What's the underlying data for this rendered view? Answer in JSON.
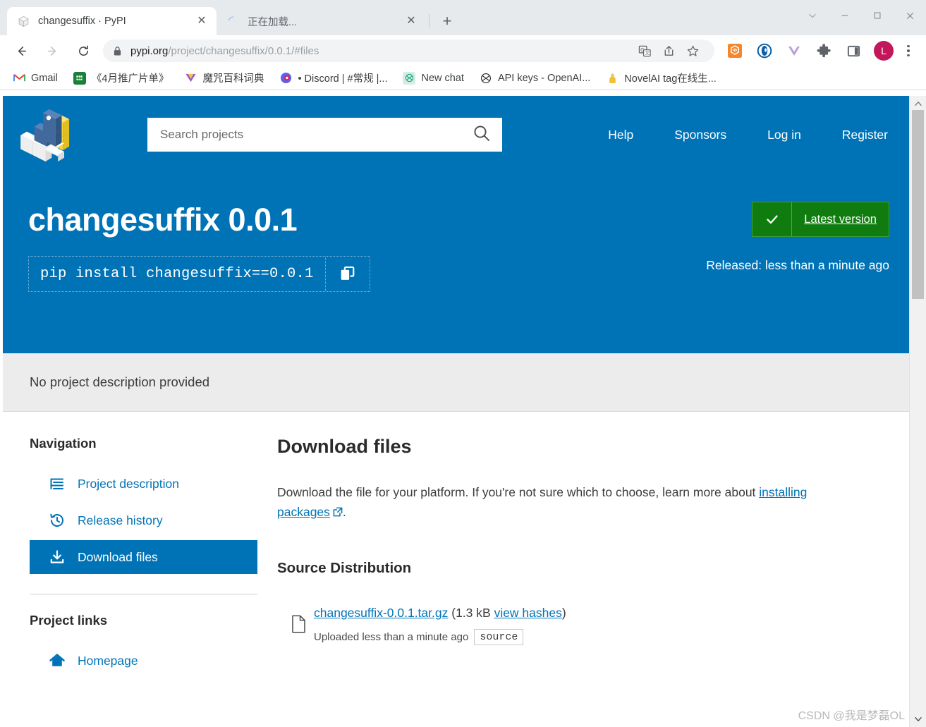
{
  "browser": {
    "tabs": [
      {
        "title": "changesuffix · PyPI",
        "active": true,
        "favicon": "package-icon",
        "close_label": "✕"
      },
      {
        "title": "正在加载...",
        "active": false,
        "favicon": "loading-spinner-icon",
        "close_label": "✕"
      }
    ],
    "new_tab_label": "+",
    "window_controls": {
      "tab_search": "⌄",
      "minimize": "—",
      "maximize": "□",
      "close": "✕"
    },
    "toolbar": {
      "back_label": "←",
      "forward_label": "→",
      "reload_label": "↻",
      "url_prefix": "pypi.org",
      "url_suffix": "/project/changesuffix/0.0.1/#files",
      "lock_icon": "lock-icon",
      "translate_icon": "translate-icon",
      "share_icon": "share-icon",
      "bookmark_icon": "star-icon",
      "profile_initial": "L"
    },
    "extensions": [
      {
        "name": "honey-extension-icon",
        "glyph": "✚",
        "color": "#f5872a"
      },
      {
        "name": "opera-gx-extension-icon",
        "glyph": "◉",
        "color": "#0b5fa5"
      },
      {
        "name": "vue-devtools-extension-icon",
        "glyph": "▼",
        "color": "#b9a0d6"
      },
      {
        "name": "puzzle-extensions-icon",
        "glyph": "✻",
        "color": "#5f6368"
      },
      {
        "name": "sidepanel-icon",
        "glyph": "▣",
        "color": "#5f6368"
      }
    ],
    "bookmarks": [
      {
        "label": "Gmail",
        "icon": "gmail-icon",
        "glyph": "M",
        "color": "#ea4335",
        "bg": "transparent"
      },
      {
        "label": "《4月推广片单》",
        "icon": "google-sheets-icon",
        "glyph": "≡",
        "color": "#ffffff",
        "bg": "#188038"
      },
      {
        "label": "魔咒百科词典",
        "icon": "v-site-icon",
        "glyph": "▼",
        "color": "#8e44ad",
        "bg": "transparent"
      },
      {
        "label": "• Discord | #常规 |...",
        "icon": "discord-icon",
        "glyph": "◉",
        "color": "#e01e5a",
        "bg": "transparent"
      },
      {
        "label": "New chat",
        "icon": "chatgpt-icon",
        "glyph": "◎",
        "color": "#10a37f",
        "bg": "#e6f4ef"
      },
      {
        "label": "API keys - OpenAI...",
        "icon": "openai-icon",
        "glyph": "◎",
        "color": "#202123",
        "bg": "transparent"
      },
      {
        "label": "NovelAI tag在线生...",
        "icon": "novelai-icon",
        "glyph": "♟",
        "color": "#d4a017",
        "bg": "transparent"
      }
    ]
  },
  "pypi": {
    "logo_name": "pypi-logo",
    "search": {
      "placeholder": "Search projects",
      "value": "",
      "icon": "search-icon"
    },
    "nav": [
      {
        "label": "Help"
      },
      {
        "label": "Sponsors"
      },
      {
        "label": "Log in"
      },
      {
        "label": "Register"
      }
    ],
    "banner": {
      "package_title": "changesuffix 0.0.1",
      "pip_command": "pip install changesuffix==0.0.1",
      "copy_icon": "copy-icon",
      "version_badge": {
        "check": "✓",
        "label": "Latest version"
      },
      "released": "Released: less than a minute ago"
    },
    "description_notice": "No project description provided",
    "sidebar": {
      "navigation_heading": "Navigation",
      "nav_items": [
        {
          "label": "Project description",
          "icon": "list-lines-icon",
          "active": false
        },
        {
          "label": "Release history",
          "icon": "history-clock-icon",
          "active": false
        },
        {
          "label": "Download files",
          "icon": "download-icon",
          "active": true
        }
      ],
      "project_links_heading": "Project links",
      "project_links": [
        {
          "label": "Homepage",
          "icon": "home-icon"
        }
      ]
    },
    "main": {
      "heading": "Download files",
      "lead_before": "Download the file for your platform. If you're not sure which to choose, learn more about ",
      "lead_link": "installing packages",
      "lead_after": ".",
      "external_icon": "external-link-icon",
      "section_heading": "Source Distribution",
      "file": {
        "icon": "file-icon",
        "name": "changesuffix-0.0.1.tar.gz",
        "size_open": " (",
        "size": "1.3 kB",
        "hashes_link": "view hashes",
        "size_close": ")",
        "uploaded": "Uploaded less than a minute ago",
        "tag": "source"
      }
    }
  },
  "scrollbar": {
    "up_arrow": "▲",
    "down_arrow": "▼"
  },
  "watermark": "CSDN @我是梦磊OL",
  "colors": {
    "pypi_blue": "#0073b7",
    "badge_green": "#107c10",
    "chrome_tabstrip": "#e7eaed",
    "link_blue": "#0073b7",
    "banner_gray": "#ececec"
  }
}
